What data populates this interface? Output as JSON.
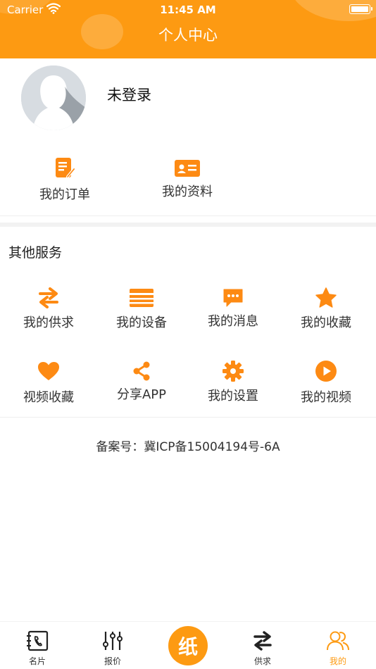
{
  "status_bar": {
    "carrier": "Carrier",
    "time": "11:45 AM"
  },
  "header": {
    "title": "个人中心"
  },
  "profile": {
    "username": "未登录"
  },
  "quick_actions": [
    {
      "label": "我的订单",
      "icon": "order-edit-icon"
    },
    {
      "label": "我的资料",
      "icon": "profile-card-icon"
    }
  ],
  "services": {
    "title": "其他服务",
    "items": [
      {
        "label": "我的供求",
        "icon": "swap-arrows-icon"
      },
      {
        "label": "我的设备",
        "icon": "equipment-icon"
      },
      {
        "label": "我的消息",
        "icon": "message-icon"
      },
      {
        "label": "我的收藏",
        "icon": "star-icon"
      },
      {
        "label": "视频收藏",
        "icon": "heart-icon"
      },
      {
        "label": "分享APP",
        "icon": "share-icon"
      },
      {
        "label": "我的设置",
        "icon": "gear-icon"
      },
      {
        "label": "我的视频",
        "icon": "play-icon"
      }
    ]
  },
  "footer": {
    "icp": "备案号：冀ICP备15004194号-6A"
  },
  "tabbar": {
    "items": [
      {
        "label": "名片",
        "icon": "business-card-icon"
      },
      {
        "label": "报价",
        "icon": "sliders-icon"
      },
      {
        "label": "纸",
        "icon": "paper-center-icon"
      },
      {
        "label": "供求",
        "icon": "swap-arrows-icon"
      },
      {
        "label": "我的",
        "icon": "users-icon"
      }
    ],
    "active": "我的"
  },
  "colors": {
    "accent": "#fd9a12",
    "text": "#333333",
    "background": "#ffffff"
  }
}
